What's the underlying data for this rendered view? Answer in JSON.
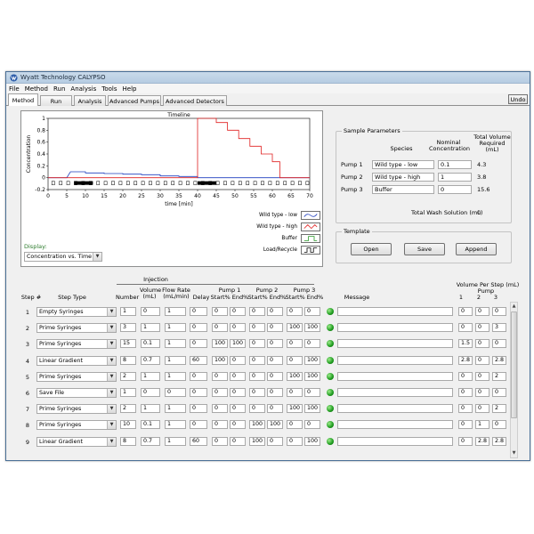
{
  "window": {
    "title": "Wyatt Technology CALYPSO"
  },
  "menu": [
    "File",
    "Method",
    "Run",
    "Analysis",
    "Tools",
    "Help"
  ],
  "tabs": [
    "Method",
    "Run",
    "Analysis",
    "Advanced Pumps",
    "Advanced Detectors"
  ],
  "undo_label": "Undo",
  "chart": {
    "title": "Timeline",
    "ylabel": "Concentration",
    "xlabel": "time [min]",
    "xticks": [
      "0",
      "5",
      "10",
      "15",
      "20",
      "25",
      "30",
      "35",
      "40",
      "45",
      "50",
      "55",
      "60",
      "65",
      "70"
    ],
    "yticks": [
      "1",
      "0.8",
      "0.6",
      "0.4",
      "0.2",
      "0",
      "-0.2"
    ],
    "legend": [
      "Wild type - low",
      "Wild type - high",
      "Buffer",
      "Load/Recycle"
    ],
    "display_label": "Display:",
    "display_value": "Concentration vs. Time"
  },
  "chart_data": {
    "type": "line",
    "title": "Timeline",
    "xlabel": "time [min]",
    "ylabel": "Concentration",
    "xlim": [
      0,
      70
    ],
    "ylim": [
      -0.2,
      1
    ],
    "series": [
      {
        "name": "Wild type - low",
        "color": "#1f3fbf",
        "x": [
          0,
          5,
          6,
          10,
          10,
          15,
          15,
          20,
          20,
          25,
          25,
          30,
          30,
          35,
          35,
          40,
          40,
          70
        ],
        "y": [
          0,
          0,
          0.1,
          0.1,
          0.08,
          0.08,
          0.07,
          0.07,
          0.06,
          0.06,
          0.05,
          0.05,
          0.03,
          0.03,
          0.02,
          0.02,
          0,
          0
        ]
      },
      {
        "name": "Wild type - high",
        "color": "#e02020",
        "x": [
          0,
          40,
          40,
          45,
          45,
          48,
          48,
          51,
          51,
          54,
          54,
          57,
          57,
          60,
          60,
          62,
          62,
          70
        ],
        "y": [
          0,
          0,
          1,
          1,
          0.93,
          0.93,
          0.8,
          0.8,
          0.66,
          0.66,
          0.53,
          0.53,
          0.4,
          0.4,
          0.27,
          0.27,
          0,
          0
        ]
      }
    ]
  },
  "sample": {
    "title": "Sample Parameters",
    "col_species": "Species",
    "col_nominal": "Nominal Concentration",
    "col_total": "Total Volume Required (mL)",
    "rows": [
      {
        "pump": "Pump 1",
        "species": "Wild type - low",
        "conc": "0.1",
        "vol": "4.3"
      },
      {
        "pump": "Pump 2",
        "species": "Wild type - high",
        "conc": "1",
        "vol": "3.8"
      },
      {
        "pump": "Pump 3",
        "species": "Buffer",
        "conc": "0",
        "vol": "15.6"
      }
    ],
    "wash_label": "Total Wash Solution (mL)",
    "wash_value": "0"
  },
  "template": {
    "title": "Template",
    "open": "Open",
    "save": "Save",
    "append": "Append"
  },
  "steps_header": {
    "injection": "Injection",
    "step": "Step #",
    "type": "Step Type",
    "number": "Number",
    "volume": "Volume (mL)",
    "flow": "Flow Rate (mL/min)",
    "delay": "Delay",
    "pump1": "Pump 1",
    "pump2": "Pump 2",
    "pump3": "Pump 3",
    "startend": "Start% End%",
    "message": "Message",
    "vps": "Volume Per Step (mL)",
    "vps_pump": "Pump",
    "vps_cols": [
      "1",
      "2",
      "3"
    ]
  },
  "steps": [
    {
      "n": "1",
      "type": "Empty Syringes",
      "num": "1",
      "vol": "0",
      "flow": "1",
      "delay": "0",
      "p1s": "0",
      "p1e": "0",
      "p2s": "0",
      "p2e": "0",
      "p3s": "0",
      "p3e": "0",
      "v1": "0",
      "v2": "0",
      "v3": "0"
    },
    {
      "n": "2",
      "type": "Prime Syringes",
      "num": "3",
      "vol": "1",
      "flow": "1",
      "delay": "0",
      "p1s": "0",
      "p1e": "0",
      "p2s": "0",
      "p2e": "0",
      "p3s": "100",
      "p3e": "100",
      "v1": "0",
      "v2": "0",
      "v3": "3"
    },
    {
      "n": "3",
      "type": "Prime Syringes",
      "num": "15",
      "vol": "0.1",
      "flow": "1",
      "delay": "0",
      "p1s": "100",
      "p1e": "100",
      "p2s": "0",
      "p2e": "0",
      "p3s": "0",
      "p3e": "0",
      "v1": "1.5",
      "v2": "0",
      "v3": "0"
    },
    {
      "n": "4",
      "type": "Linear Gradient",
      "num": "8",
      "vol": "0.7",
      "flow": "1",
      "delay": "60",
      "p1s": "100",
      "p1e": "0",
      "p2s": "0",
      "p2e": "0",
      "p3s": "0",
      "p3e": "100",
      "v1": "2.8",
      "v2": "0",
      "v3": "2.8"
    },
    {
      "n": "5",
      "type": "Prime Syringes",
      "num": "2",
      "vol": "1",
      "flow": "1",
      "delay": "0",
      "p1s": "0",
      "p1e": "0",
      "p2s": "0",
      "p2e": "0",
      "p3s": "100",
      "p3e": "100",
      "v1": "0",
      "v2": "0",
      "v3": "2"
    },
    {
      "n": "6",
      "type": "Save File",
      "num": "1",
      "vol": "0",
      "flow": "0",
      "delay": "0",
      "p1s": "0",
      "p1e": "0",
      "p2s": "0",
      "p2e": "0",
      "p3s": "0",
      "p3e": "0",
      "v1": "0",
      "v2": "0",
      "v3": "0"
    },
    {
      "n": "7",
      "type": "Prime Syringes",
      "num": "2",
      "vol": "1",
      "flow": "1",
      "delay": "0",
      "p1s": "0",
      "p1e": "0",
      "p2s": "0",
      "p2e": "0",
      "p3s": "100",
      "p3e": "100",
      "v1": "0",
      "v2": "0",
      "v3": "2"
    },
    {
      "n": "8",
      "type": "Prime Syringes",
      "num": "10",
      "vol": "0.1",
      "flow": "1",
      "delay": "0",
      "p1s": "0",
      "p1e": "0",
      "p2s": "100",
      "p2e": "100",
      "p3s": "0",
      "p3e": "0",
      "v1": "0",
      "v2": "1",
      "v3": "0"
    },
    {
      "n": "9",
      "type": "Linear Gradient",
      "num": "8",
      "vol": "0.7",
      "flow": "1",
      "delay": "60",
      "p1s": "0",
      "p1e": "0",
      "p2s": "100",
      "p2e": "0",
      "p3s": "0",
      "p3e": "100",
      "v1": "0",
      "v2": "2.8",
      "v3": "2.8"
    }
  ],
  "colors": {
    "accent_blue": "#1f3fbf",
    "accent_red": "#e02020",
    "led_green": "#1d9a1d",
    "display_label": "#2a7a2a"
  }
}
